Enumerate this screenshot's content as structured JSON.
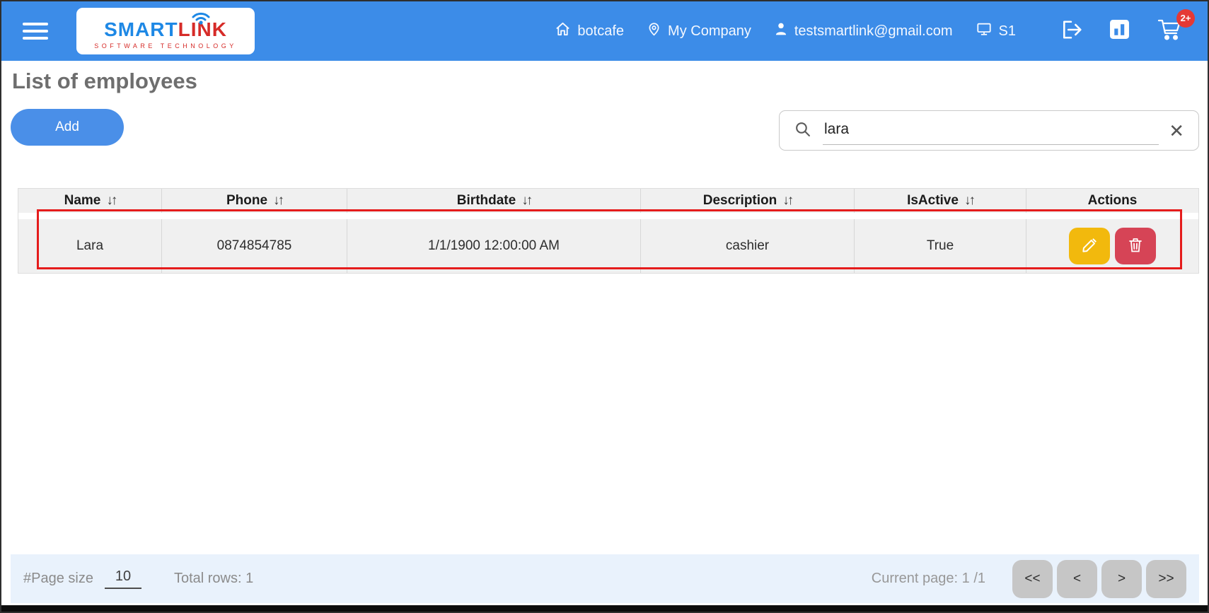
{
  "topbar": {
    "brand": {
      "name_part1": "SMART",
      "name_part2": "LINK",
      "subtitle": "SOFTWARE TECHNOLOGY"
    },
    "items": [
      {
        "icon": "home-icon",
        "label": "botcafe"
      },
      {
        "icon": "location-pin-icon",
        "label": "My Company"
      },
      {
        "icon": "user-icon",
        "label": "testsmartlink@gmail.com"
      },
      {
        "icon": "monitor-icon",
        "label": "S1"
      }
    ],
    "cart_badge": "2+"
  },
  "page": {
    "title": "List of employees"
  },
  "toolbar": {
    "add_label": "Add",
    "search_value": "lara",
    "clear_glyph": "✕"
  },
  "table": {
    "sort_glyph": "↓↑",
    "columns": [
      {
        "label": "Name",
        "sortable": true
      },
      {
        "label": "Phone",
        "sortable": true
      },
      {
        "label": "Birthdate",
        "sortable": true
      },
      {
        "label": "Description",
        "sortable": true
      },
      {
        "label": "IsActive",
        "sortable": true
      },
      {
        "label": "Actions",
        "sortable": false
      }
    ],
    "rows": [
      {
        "name": "Lara",
        "phone": "0874854785",
        "birthdate": "1/1/1900 12:00:00 AM",
        "description": "cashier",
        "isactive": "True"
      }
    ]
  },
  "footer": {
    "page_size_label": "#Page size",
    "page_size_value": "10",
    "total_rows_label": "Total rows: 1",
    "current_page_label": "Current page: 1 /1",
    "pagination": [
      "<<",
      "<",
      ">",
      ">>"
    ]
  },
  "colors": {
    "topbar_blue": "#3c8ce8",
    "brand_blue": "#1e88e5",
    "brand_red": "#d62b28",
    "highlight_red": "#e51c1c",
    "edit_yellow": "#f2b90d",
    "delete_red": "#d64456",
    "footer_bg": "#e9f2fc",
    "badge_red": "#e53935"
  }
}
